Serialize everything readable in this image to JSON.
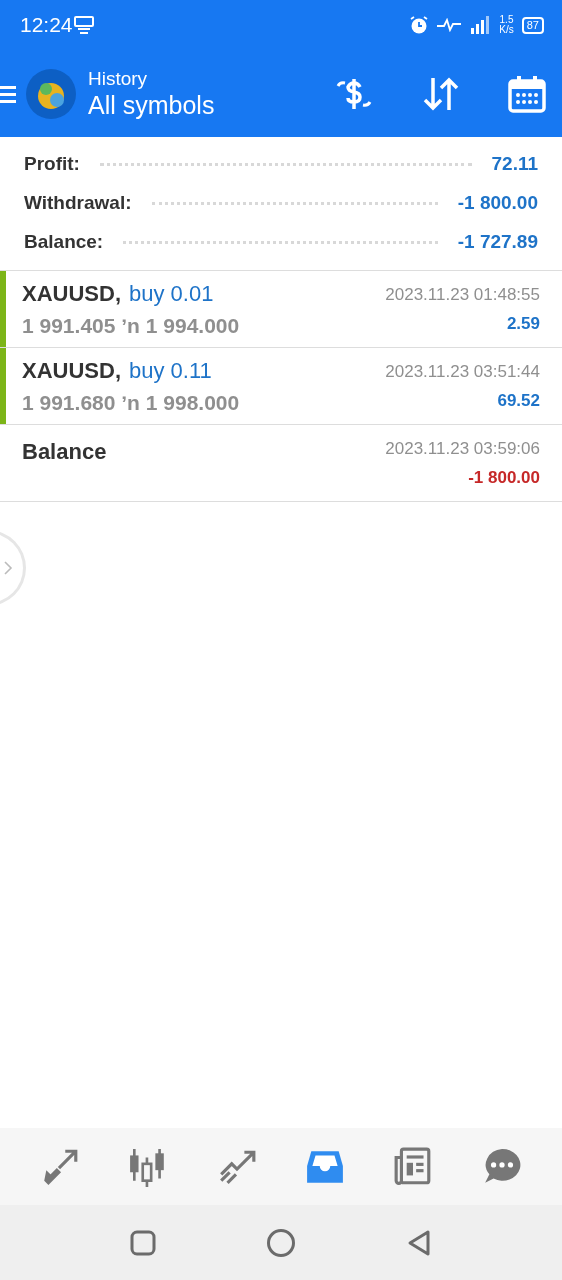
{
  "status_bar": {
    "time": "12:24",
    "net_speed": "1.5",
    "net_unit": "K/s",
    "battery": "87"
  },
  "header": {
    "title": "History",
    "subtitle": "All symbols"
  },
  "summary": [
    {
      "label": "Profit:",
      "value": "72.11"
    },
    {
      "label": "Withdrawal:",
      "value": "-1 800.00"
    },
    {
      "label": "Balance:",
      "value": "-1 727.89"
    }
  ],
  "deals": [
    {
      "kind": "trade",
      "symbol": "XAUUSD,",
      "action": "buy 0.01",
      "prices": "1 991.405 ʼn  1 994.000",
      "time": "2023.11.23 01:48:55",
      "amount": "2.59",
      "color": "#1e73c8"
    },
    {
      "kind": "trade",
      "symbol": "XAUUSD,",
      "action": "buy 0.11",
      "prices": "1 991.680 ʼn  1 998.000",
      "time": "2023.11.23 03:51:44",
      "amount": "69.52",
      "color": "#1e73c8"
    },
    {
      "kind": "balance",
      "symbol": "Balance",
      "time": "2023.11.23 03:59:06",
      "amount": "-1 800.00",
      "color": "#c62828"
    }
  ],
  "bottom_nav": [
    {
      "kind": "trade",
      "selected": false
    },
    {
      "kind": "chart",
      "selected": false
    },
    {
      "kind": "quotes",
      "selected": false
    },
    {
      "kind": "history",
      "selected": true
    },
    {
      "kind": "news",
      "selected": false
    },
    {
      "kind": "chat",
      "selected": false
    }
  ]
}
